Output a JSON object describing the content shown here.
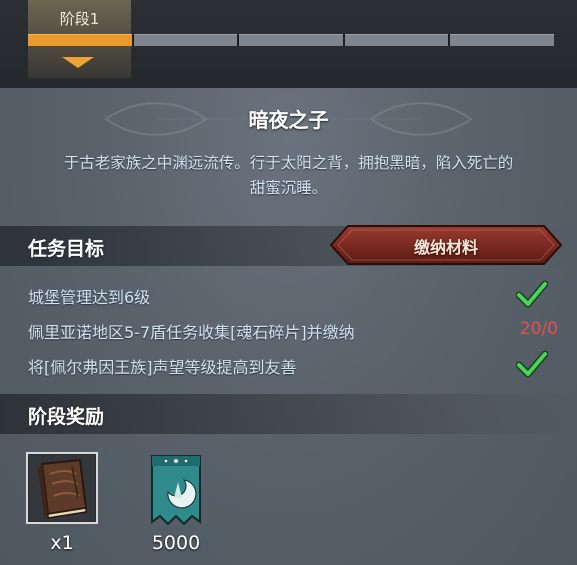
{
  "stage": {
    "label": "阶段1",
    "progress": {
      "filled_segments": 1,
      "total_segments": 5
    }
  },
  "title": "暗夜之子",
  "description_lines": [
    "于古老家族之中渊远流传。行于太阳之背，拥抱黑暗，陷入死亡的",
    "甜蜜沉睡。"
  ],
  "tasks_section": {
    "title": "任务目标",
    "submit_button_label": "缴纳材料",
    "tasks": [
      {
        "text": "城堡管理达到6级",
        "status": "complete",
        "progress": ""
      },
      {
        "text": "佩里亚诺地区5-7盾任务收集[魂石碎片]并缴纳",
        "status": "incomplete",
        "progress": "20/0"
      },
      {
        "text": "将[佩尔弗因王族]声望等级提高到友善",
        "status": "complete",
        "progress": ""
      }
    ]
  },
  "rewards_section": {
    "title": "阶段奖励",
    "rewards": [
      {
        "icon": "book-icon",
        "quantity": "x1"
      },
      {
        "icon": "moon-banner-icon",
        "quantity": "5000"
      }
    ]
  },
  "colors": {
    "accent_orange": "#e89a2e",
    "check_green": "#4bd35a",
    "progress_red": "#e2514c",
    "button_red": "#7a2a22"
  }
}
